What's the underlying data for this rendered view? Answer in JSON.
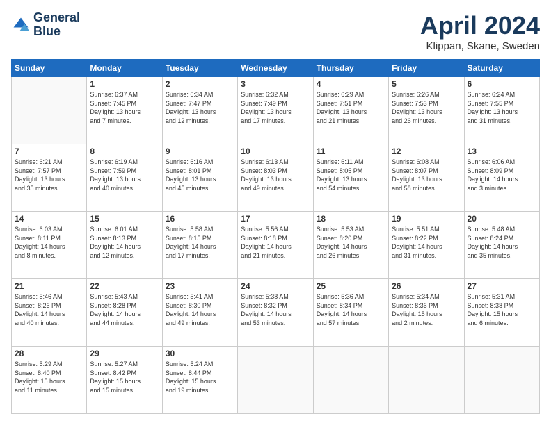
{
  "header": {
    "logo_line1": "General",
    "logo_line2": "Blue",
    "month": "April 2024",
    "location": "Klippan, Skane, Sweden"
  },
  "days_of_week": [
    "Sunday",
    "Monday",
    "Tuesday",
    "Wednesday",
    "Thursday",
    "Friday",
    "Saturday"
  ],
  "weeks": [
    [
      {
        "day": "",
        "info": ""
      },
      {
        "day": "1",
        "info": "Sunrise: 6:37 AM\nSunset: 7:45 PM\nDaylight: 13 hours\nand 7 minutes."
      },
      {
        "day": "2",
        "info": "Sunrise: 6:34 AM\nSunset: 7:47 PM\nDaylight: 13 hours\nand 12 minutes."
      },
      {
        "day": "3",
        "info": "Sunrise: 6:32 AM\nSunset: 7:49 PM\nDaylight: 13 hours\nand 17 minutes."
      },
      {
        "day": "4",
        "info": "Sunrise: 6:29 AM\nSunset: 7:51 PM\nDaylight: 13 hours\nand 21 minutes."
      },
      {
        "day": "5",
        "info": "Sunrise: 6:26 AM\nSunset: 7:53 PM\nDaylight: 13 hours\nand 26 minutes."
      },
      {
        "day": "6",
        "info": "Sunrise: 6:24 AM\nSunset: 7:55 PM\nDaylight: 13 hours\nand 31 minutes."
      }
    ],
    [
      {
        "day": "7",
        "info": "Sunrise: 6:21 AM\nSunset: 7:57 PM\nDaylight: 13 hours\nand 35 minutes."
      },
      {
        "day": "8",
        "info": "Sunrise: 6:19 AM\nSunset: 7:59 PM\nDaylight: 13 hours\nand 40 minutes."
      },
      {
        "day": "9",
        "info": "Sunrise: 6:16 AM\nSunset: 8:01 PM\nDaylight: 13 hours\nand 45 minutes."
      },
      {
        "day": "10",
        "info": "Sunrise: 6:13 AM\nSunset: 8:03 PM\nDaylight: 13 hours\nand 49 minutes."
      },
      {
        "day": "11",
        "info": "Sunrise: 6:11 AM\nSunset: 8:05 PM\nDaylight: 13 hours\nand 54 minutes."
      },
      {
        "day": "12",
        "info": "Sunrise: 6:08 AM\nSunset: 8:07 PM\nDaylight: 13 hours\nand 58 minutes."
      },
      {
        "day": "13",
        "info": "Sunrise: 6:06 AM\nSunset: 8:09 PM\nDaylight: 14 hours\nand 3 minutes."
      }
    ],
    [
      {
        "day": "14",
        "info": "Sunrise: 6:03 AM\nSunset: 8:11 PM\nDaylight: 14 hours\nand 8 minutes."
      },
      {
        "day": "15",
        "info": "Sunrise: 6:01 AM\nSunset: 8:13 PM\nDaylight: 14 hours\nand 12 minutes."
      },
      {
        "day": "16",
        "info": "Sunrise: 5:58 AM\nSunset: 8:15 PM\nDaylight: 14 hours\nand 17 minutes."
      },
      {
        "day": "17",
        "info": "Sunrise: 5:56 AM\nSunset: 8:18 PM\nDaylight: 14 hours\nand 21 minutes."
      },
      {
        "day": "18",
        "info": "Sunrise: 5:53 AM\nSunset: 8:20 PM\nDaylight: 14 hours\nand 26 minutes."
      },
      {
        "day": "19",
        "info": "Sunrise: 5:51 AM\nSunset: 8:22 PM\nDaylight: 14 hours\nand 31 minutes."
      },
      {
        "day": "20",
        "info": "Sunrise: 5:48 AM\nSunset: 8:24 PM\nDaylight: 14 hours\nand 35 minutes."
      }
    ],
    [
      {
        "day": "21",
        "info": "Sunrise: 5:46 AM\nSunset: 8:26 PM\nDaylight: 14 hours\nand 40 minutes."
      },
      {
        "day": "22",
        "info": "Sunrise: 5:43 AM\nSunset: 8:28 PM\nDaylight: 14 hours\nand 44 minutes."
      },
      {
        "day": "23",
        "info": "Sunrise: 5:41 AM\nSunset: 8:30 PM\nDaylight: 14 hours\nand 49 minutes."
      },
      {
        "day": "24",
        "info": "Sunrise: 5:38 AM\nSunset: 8:32 PM\nDaylight: 14 hours\nand 53 minutes."
      },
      {
        "day": "25",
        "info": "Sunrise: 5:36 AM\nSunset: 8:34 PM\nDaylight: 14 hours\nand 57 minutes."
      },
      {
        "day": "26",
        "info": "Sunrise: 5:34 AM\nSunset: 8:36 PM\nDaylight: 15 hours\nand 2 minutes."
      },
      {
        "day": "27",
        "info": "Sunrise: 5:31 AM\nSunset: 8:38 PM\nDaylight: 15 hours\nand 6 minutes."
      }
    ],
    [
      {
        "day": "28",
        "info": "Sunrise: 5:29 AM\nSunset: 8:40 PM\nDaylight: 15 hours\nand 11 minutes."
      },
      {
        "day": "29",
        "info": "Sunrise: 5:27 AM\nSunset: 8:42 PM\nDaylight: 15 hours\nand 15 minutes."
      },
      {
        "day": "30",
        "info": "Sunrise: 5:24 AM\nSunset: 8:44 PM\nDaylight: 15 hours\nand 19 minutes."
      },
      {
        "day": "",
        "info": ""
      },
      {
        "day": "",
        "info": ""
      },
      {
        "day": "",
        "info": ""
      },
      {
        "day": "",
        "info": ""
      }
    ]
  ]
}
